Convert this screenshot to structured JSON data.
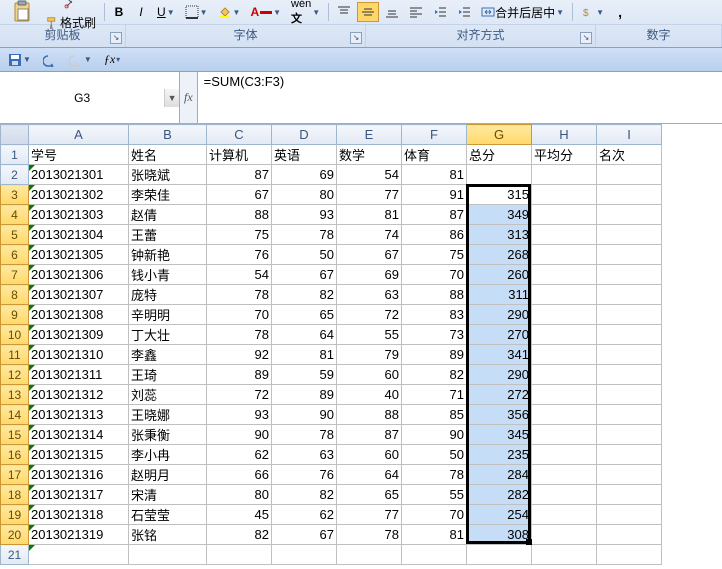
{
  "ribbon": {
    "paste_label": "粘贴",
    "format_painter": "格式刷",
    "groups": {
      "clipboard": "剪贴板",
      "font": "字体",
      "alignment": "对齐方式",
      "number": "数字"
    },
    "merge_center": "合并后居中"
  },
  "namebox": {
    "value": "G3"
  },
  "formula": {
    "value": "=SUM(C3:F3)"
  },
  "columns": [
    "A",
    "B",
    "C",
    "D",
    "E",
    "F",
    "G",
    "H",
    "I"
  ],
  "col_classes": [
    "col-A",
    "col-B",
    "col-C",
    "col-D",
    "col-E",
    "col-F",
    "col-G",
    "col-H",
    "col-I"
  ],
  "headers": {
    "A": "学号",
    "B": "姓名",
    "C": "计算机",
    "D": "英语",
    "E": "数学",
    "F": "体育",
    "G": "总分",
    "H": "平均分",
    "I": "名次"
  },
  "rows": [
    {
      "n": 2,
      "A": "2013021301",
      "B": "张晓斌",
      "C": 87,
      "D": 69,
      "E": 54,
      "F": 81,
      "G": ""
    },
    {
      "n": 3,
      "A": "2013021302",
      "B": "李荣佳",
      "C": 67,
      "D": 80,
      "E": 77,
      "F": 91,
      "G": 315
    },
    {
      "n": 4,
      "A": "2013021303",
      "B": "赵倩",
      "C": 88,
      "D": 93,
      "E": 81,
      "F": 87,
      "G": 349
    },
    {
      "n": 5,
      "A": "2013021304",
      "B": "王蕾",
      "C": 75,
      "D": 78,
      "E": 74,
      "F": 86,
      "G": 313
    },
    {
      "n": 6,
      "A": "2013021305",
      "B": "钟新艳",
      "C": 76,
      "D": 50,
      "E": 67,
      "F": 75,
      "G": 268
    },
    {
      "n": 7,
      "A": "2013021306",
      "B": "钱小青",
      "C": 54,
      "D": 67,
      "E": 69,
      "F": 70,
      "G": 260
    },
    {
      "n": 8,
      "A": "2013021307",
      "B": "庞特",
      "C": 78,
      "D": 82,
      "E": 63,
      "F": 88,
      "G": 311
    },
    {
      "n": 9,
      "A": "2013021308",
      "B": "辛明明",
      "C": 70,
      "D": 65,
      "E": 72,
      "F": 83,
      "G": 290
    },
    {
      "n": 10,
      "A": "2013021309",
      "B": "丁大壮",
      "C": 78,
      "D": 64,
      "E": 55,
      "F": 73,
      "G": 270
    },
    {
      "n": 11,
      "A": "2013021310",
      "B": "李鑫",
      "C": 92,
      "D": 81,
      "E": 79,
      "F": 89,
      "G": 341
    },
    {
      "n": 12,
      "A": "2013021311",
      "B": "王琦",
      "C": 89,
      "D": 59,
      "E": 60,
      "F": 82,
      "G": 290
    },
    {
      "n": 13,
      "A": "2013021312",
      "B": "刘蕊",
      "C": 72,
      "D": 89,
      "E": 40,
      "F": 71,
      "G": 272
    },
    {
      "n": 14,
      "A": "2013021313",
      "B": "王晓娜",
      "C": 93,
      "D": 90,
      "E": 88,
      "F": 85,
      "G": 356
    },
    {
      "n": 15,
      "A": "2013021314",
      "B": "张秉衡",
      "C": 90,
      "D": 78,
      "E": 87,
      "F": 90,
      "G": 345
    },
    {
      "n": 16,
      "A": "2013021315",
      "B": "李小冉",
      "C": 62,
      "D": 63,
      "E": 60,
      "F": 50,
      "G": 235
    },
    {
      "n": 17,
      "A": "2013021316",
      "B": "赵明月",
      "C": 66,
      "D": 76,
      "E": 64,
      "F": 78,
      "G": 284
    },
    {
      "n": 18,
      "A": "2013021317",
      "B": "宋清",
      "C": 80,
      "D": 82,
      "E": 65,
      "F": 55,
      "G": 282
    },
    {
      "n": 19,
      "A": "2013021318",
      "B": "石莹莹",
      "C": 45,
      "D": 62,
      "E": 77,
      "F": 70,
      "G": 254
    },
    {
      "n": 20,
      "A": "2013021319",
      "B": "张铭",
      "C": 82,
      "D": 67,
      "E": 78,
      "F": 81,
      "G": 308
    }
  ],
  "selection": {
    "col": "G",
    "row_start": 3,
    "row_end": 20,
    "active_row": 3
  }
}
